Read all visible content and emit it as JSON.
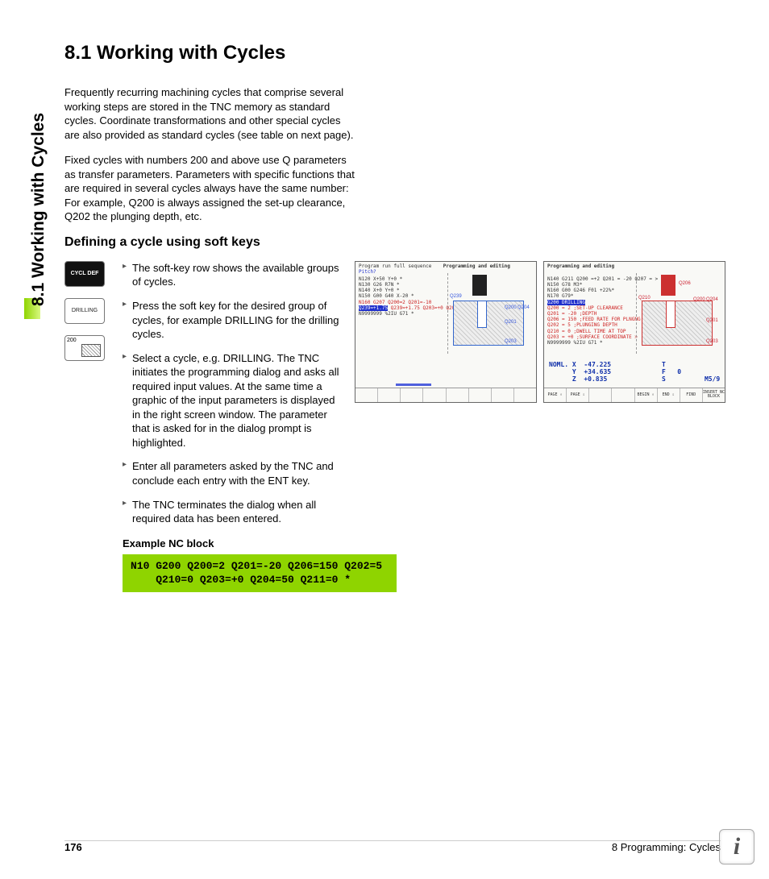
{
  "sideLabel": "8.1 Working with Cycles",
  "heading": "8.1   Working with Cycles",
  "intro": [
    "Frequently recurring machining cycles that comprise several working steps are stored in the TNC memory as standard cycles. Coordinate transformations and other special cycles are also provided as standard cycles (see table on next page).",
    "Fixed cycles with numbers 200 and above use Q parameters as transfer parameters. Parameters with specific functions that are required in several cycles always have the same number: For example, Q200 is always assigned the set-up clearance, Q202 the plunging depth, etc."
  ],
  "subheading": "Defining a cycle using soft keys",
  "softkeys": [
    {
      "label": "CYCL DEF",
      "style": "dark"
    },
    {
      "label": "DRILLING",
      "style": "light"
    },
    {
      "label": "200",
      "style": "hatch"
    }
  ],
  "steps": [
    "The soft-key row shows the available groups of cycles.",
    "Press the soft key for the desired group of cycles, for example DRILLING for the drilling cycles.",
    "Select a cycle, e.g. DRILLING. The TNC initiates the programming dialog and asks all required input values. At the same time a graphic of the input parameters is displayed in the right screen window. The parameter that is asked for in the dialog prompt is highlighted.",
    "Enter all parameters asked by the TNC and conclude each entry with the ENT key.",
    "The TNC terminates the dialog when all required data has been entered."
  ],
  "screens": {
    "left": {
      "mode": "Program run\nfull sequence",
      "title": "Programming and editing",
      "prompt": "Pitch?",
      "lines": [
        "N120 X+50 Y+0 *",
        "N130 G26 R7N *",
        "N140 X+0 Y+0 *",
        "N150 G00 G40 X-20 *",
        "N160 G207 Q200=2 Q201=-10",
        "Q239=+1.75  Q203=+0 Q204=50 *",
        "N9999999 %2IU G71 *"
      ],
      "hlLine": "Q239=+1.75",
      "graphicLabels": [
        "Q239",
        "Q200",
        "Q204",
        "Q201",
        "Q203"
      ],
      "softkeys": [
        "",
        "",
        "",
        "",
        "",
        "",
        "",
        ""
      ]
    },
    "right": {
      "mode": "",
      "title": "Programming and editing",
      "prompt": "",
      "lines": [
        "N140 G211 Q200 =+2 Q201 = -20 Q207 = >",
        "N150 G78 M3*",
        "N160 G00 G246 F01 +22%*",
        "N170 G79*",
        "G200 DRILLING",
        "Q200 = 2    ;SET-UP CLEARANCE",
        "Q201 = -20  ;DEPTH",
        "Q206 = 150  ;FEED RATE FOR PLNGNG",
        "Q202 = 5    ;PLUNGING DEPTH",
        "Q210 = 0    ;DWELL TIME AT TOP",
        "Q203 = +0   ;SURFACE COORDINATE  >",
        "N9999999 %2IU G71 *"
      ],
      "graphicLabels": [
        "Q206",
        "Q210",
        "Q200",
        "Q204",
        "Q201",
        "Q203"
      ],
      "position": {
        "X": "-47.225",
        "Y": "+34.635",
        "Z": "+0.835",
        "status": "T\nF   0\nS          M5/9"
      },
      "softkeys": [
        "PAGE ⇧",
        "PAGE ⇩",
        "",
        "",
        "BEGIN ⇧",
        "END ⇩",
        "FIND",
        "INSERT NC BLOCK"
      ]
    }
  },
  "exampleLabel": "Example NC block",
  "code": "N10 G200 Q200=2 Q201=-20 Q206=150 Q202=5\n    Q210=0 Q203=+0 Q204=50 Q211=0 *",
  "footer": {
    "pageNum": "176",
    "chapter": "8 Programming: Cycles"
  },
  "infoBadge": "i"
}
